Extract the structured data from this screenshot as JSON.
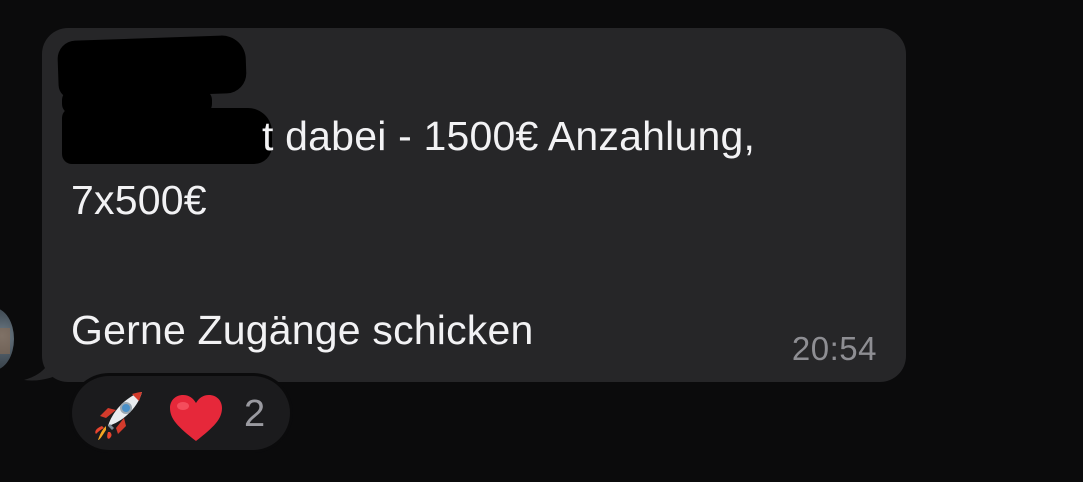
{
  "message": {
    "line1_visible": "t dabei - 1500€ Anzahlung,",
    "line2": "7x500€",
    "line3": "Gerne Zugänge schicken",
    "timestamp": "20:54"
  },
  "reactions": {
    "items": [
      {
        "icon": "rocket-icon",
        "emoji": "🚀"
      },
      {
        "icon": "heart-icon",
        "emoji": "❤️"
      }
    ],
    "count": "2"
  },
  "colors": {
    "background": "#0b0b0c",
    "bubble": "#262628",
    "text": "#f2f2f4",
    "timestamp": "#8e8e93",
    "reaction_pill": "#1b1b1d",
    "heart": "#e6283a"
  }
}
